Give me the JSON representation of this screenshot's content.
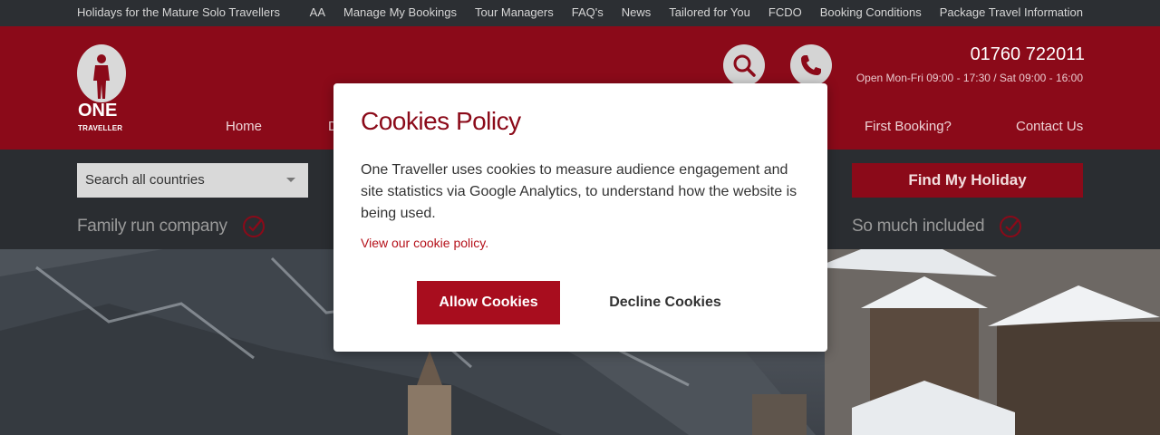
{
  "topbar": {
    "tagline": "Holidays for the Mature Solo Travellers",
    "links": [
      "AA",
      "Manage My Bookings",
      "Tour Managers",
      "FAQ's",
      "News",
      "Tailored for You",
      "FCDO",
      "Booking Conditions",
      "Package Travel Information"
    ]
  },
  "header": {
    "logo_line1": "ONE",
    "logo_line2": "TRAVELLER",
    "phone": "01760 722011",
    "hours": "Open Mon-Fri 09:00 - 17:30 / Sat 09:00 - 16:00",
    "nav": {
      "home": "Home",
      "partial": "D",
      "first_booking": "First Booking?",
      "contact": "Contact Us"
    }
  },
  "band": {
    "search_placeholder": "Search all countries",
    "find_button": "Find My Holiday",
    "usp_left": "Family run company",
    "usp_right": "So much included"
  },
  "modal": {
    "title": "Cookies Policy",
    "body": "One Traveller uses cookies to measure audience engagement and site statistics via Google Analytics, to understand how the website is being used.",
    "policy_link": "View our cookie policy.",
    "allow": "Allow Cookies",
    "decline": "Decline Cookies"
  },
  "colors": {
    "brand_red": "#8b0a19",
    "button_red": "#a80d1e",
    "dark_band": "#2a2d31"
  }
}
